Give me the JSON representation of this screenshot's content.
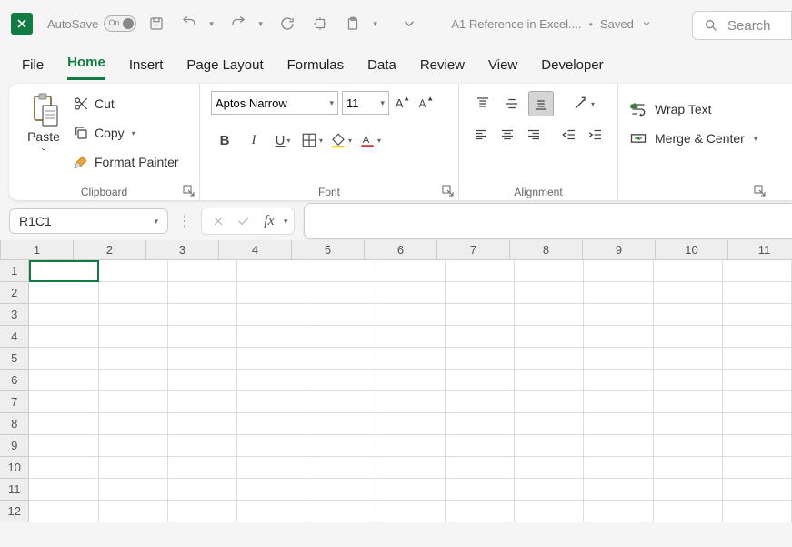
{
  "titlebar": {
    "autosave_label": "AutoSave",
    "autosave_state": "On",
    "doc_name": "A1 Reference in Excel....",
    "saved_label": "Saved",
    "search_placeholder": "Search"
  },
  "tabs": [
    "File",
    "Home",
    "Insert",
    "Page Layout",
    "Formulas",
    "Data",
    "Review",
    "View",
    "Developer"
  ],
  "active_tab": "Home",
  "ribbon": {
    "clipboard": {
      "label": "Clipboard",
      "paste": "Paste",
      "cut": "Cut",
      "copy": "Copy",
      "format_painter": "Format Painter"
    },
    "font": {
      "label": "Font",
      "name": "Aptos Narrow",
      "size": "11"
    },
    "alignment": {
      "label": "Alignment",
      "wrap": "Wrap Text",
      "merge": "Merge & Center"
    }
  },
  "formula_bar": {
    "name_box": "R1C1"
  },
  "grid": {
    "columns": [
      "1",
      "2",
      "3",
      "4",
      "5",
      "6",
      "7",
      "8",
      "9",
      "10",
      "11"
    ],
    "rows": [
      "1",
      "2",
      "3",
      "4",
      "5",
      "6",
      "7",
      "8",
      "9",
      "10",
      "11",
      "12"
    ],
    "selected": {
      "row": 0,
      "col": 0
    }
  }
}
